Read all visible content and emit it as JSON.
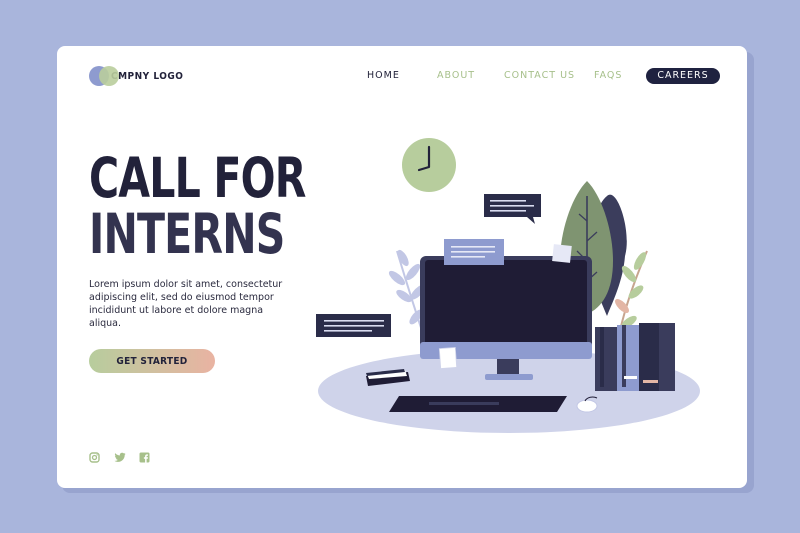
{
  "header": {
    "logo_text": "CMPNY LOGO",
    "nav": [
      {
        "label": "HOME"
      },
      {
        "label": "ABOUT"
      },
      {
        "label": "CONTACT US"
      },
      {
        "label": "FAQS"
      },
      {
        "label": "CAREERS"
      }
    ]
  },
  "hero": {
    "title_line1": "CALL FOR",
    "title_line2": "INTERNS",
    "description": "Lorem ipsum dolor sit amet, consectetur adipiscing elit, sed do eiusmod tempor incididunt ut labore et dolore magna aliqua.",
    "cta_label": "GET STARTED"
  },
  "social": {
    "icons": [
      "instagram-icon",
      "twitter-icon",
      "facebook-icon"
    ]
  },
  "colors": {
    "background": "#a9b5dc",
    "card": "#ffffff",
    "dark": "#1f2240",
    "green": "#a7c08b",
    "lavender": "#8e9bcf",
    "peach": "#e9b3a2"
  }
}
